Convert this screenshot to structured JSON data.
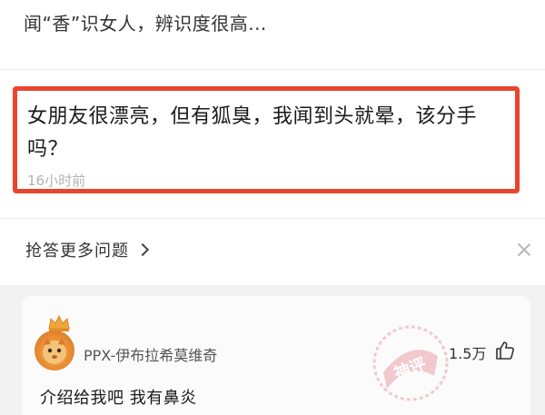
{
  "previous_item": {
    "title": "闻“香”识女人，辨识度很高..."
  },
  "highlighted_question": {
    "title": "女朋友很漂亮，但有狐臭，我闻到头就晕，该分手吗？",
    "time": "16小时前",
    "highlight_color": "#e8452f"
  },
  "more_questions": {
    "label": "抢答更多问题"
  },
  "comment": {
    "username": "PPX-伊布拉希莫维奇",
    "likes": "1.5万",
    "text": "介绍给我吧 我有鼻炎",
    "stamp_text": "神评",
    "stamp_color": "#e06d7a"
  },
  "icons": {
    "chevron": "chevron-right-icon",
    "close": "close-icon",
    "like": "thumb-up-icon",
    "crown": "crown-icon",
    "stamp": "stamp-icon"
  }
}
